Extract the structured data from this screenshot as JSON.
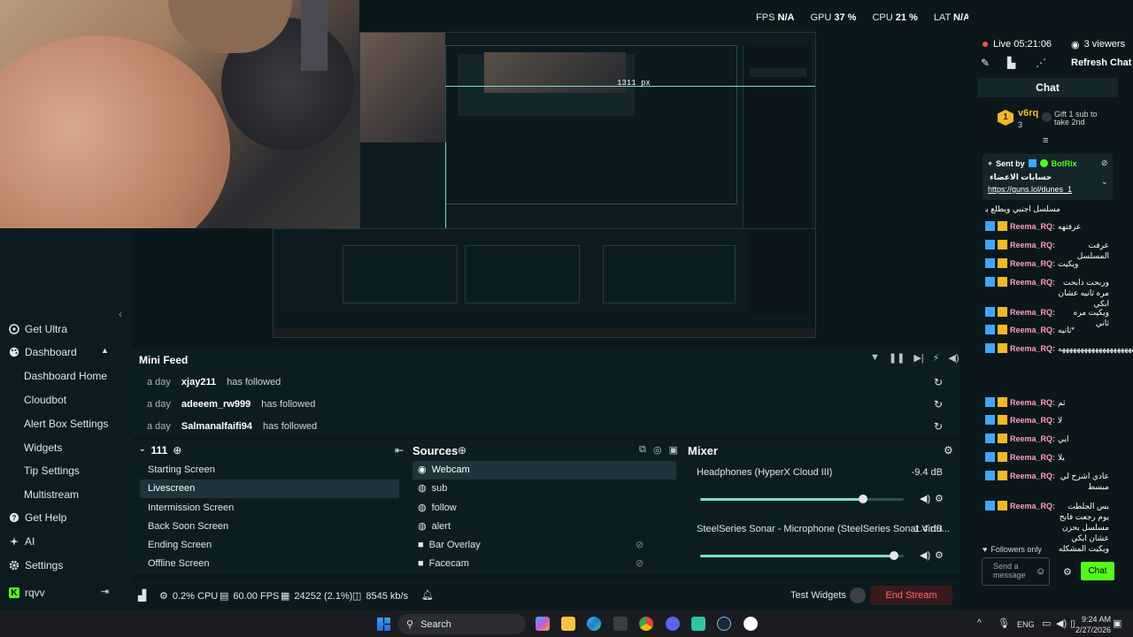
{
  "stats": {
    "fps_label": "FPS",
    "fps_value": "N/A",
    "gpu_label": "GPU",
    "gpu_value": "37 %",
    "cpu_label": "CPU",
    "cpu_value": "21 %",
    "lat_label": "LAT",
    "lat_value": "N/A"
  },
  "live": {
    "status": "Live 05:21:06",
    "viewers": "3 viewers",
    "refresh": "Refresh Chat"
  },
  "sidebar": {
    "get_ultra": "Get Ultra",
    "dashboard": "Dashboard",
    "dashboard_home": "Dashboard Home",
    "cloudbot": "Cloudbot",
    "alert_box": "Alert Box Settings",
    "widgets": "Widgets",
    "tip_settings": "Tip Settings",
    "multistream": "Multistream",
    "get_help": "Get Help",
    "ai": "AI",
    "settings": "Settings",
    "user": "rqvv"
  },
  "preview": {
    "measure_label": "1311 px"
  },
  "minifeed": {
    "title": "Mini Feed",
    "rows": [
      {
        "age": "a day",
        "user": "xjay211",
        "action": "has followed"
      },
      {
        "age": "a day",
        "user": "adeeem_rw999",
        "action": "has followed"
      },
      {
        "age": "a day",
        "user": "Salmanalfaifi94",
        "action": "has followed"
      }
    ]
  },
  "scenes": {
    "collection": "111",
    "items": [
      "Starting Screen",
      "Livescreen",
      "Intermission Screen",
      "Back Soon Screen",
      "Ending Screen",
      "Offline Screen"
    ]
  },
  "sources": {
    "title": "Sources",
    "items": [
      "Webcam",
      "sub",
      "follow",
      "alert",
      "Bar Overlay",
      "Facecam"
    ]
  },
  "mixer": {
    "title": "Mixer",
    "channels": [
      {
        "name": "Headphones (HyperX Cloud III)",
        "db": "-9.4 dB",
        "level": 0.8
      },
      {
        "name": "SteelSeries Sonar - Microphone (SteelSeries Sonar Virtu...",
        "db": "-1.4 dB",
        "level": 0.95
      }
    ]
  },
  "statusbar": {
    "cpu": "0.2% CPU",
    "fps": "60.00 FPS",
    "frames": "24252 (2.1%)",
    "bitrate": "8545 kb/s",
    "test_widgets": "Test Widgets",
    "end_stream": "End Stream"
  },
  "chat": {
    "title": "Chat",
    "top_user": "v6rq",
    "top_rank": "3",
    "gift_text": "Gift 1 sub to take 2nd",
    "pinned_label": "Sent by",
    "pinned_bot": "BotRix",
    "pinned_title": "حسابات الاعضاء",
    "pinned_link": "https://guns.lol/dunes_1",
    "overflow_line": "مسلسل اجنبي ويطلع بحزن",
    "messages": [
      {
        "name": "Reema_RQ:",
        "msg": "عرفتهه"
      },
      {
        "name": "Reema_RQ:",
        "msg": "عرفت المسلسل"
      },
      {
        "name": "Reema_RQ:",
        "msg": "ويكيت"
      },
      {
        "name": "Reema_RQ:",
        "msg": "وربحت ذابحت مره ثانيه عشان ابكي"
      },
      {
        "name": "Reema_RQ:",
        "msg": "ويكيت مره ثاني"
      },
      {
        "name": "Reema_RQ:",
        "msg": "*ثانيه"
      },
      {
        "name": "Reema_RQ:",
        "msg": "ههههههههههههههههههههههههههههه"
      },
      {
        "name": "Reema_RQ:",
        "msg": "ثم"
      },
      {
        "name": "Reema_RQ:",
        "msg": "لا"
      },
      {
        "name": "Reema_RQ:",
        "msg": "ايي"
      },
      {
        "name": "Reema_RQ:",
        "msg": "يلا"
      },
      {
        "name": "Reema_RQ:",
        "msg": "عادي اشرح لي مبسط"
      },
      {
        "name": "Reema_RQ:",
        "msg": "بس الجلطت يوم رجعت فابح مسلسل بحزن عشان ابكي ويكيت المشكله"
      }
    ],
    "followers_only": "Followers only",
    "input_placeholder": "Send a message",
    "send_label": "Chat"
  },
  "taskbar": {
    "search_label": "Search",
    "lang": "ENG",
    "time": "9:24 AM",
    "date": "2/27/2026"
  },
  "colors": {
    "accent": "#53fc18",
    "teal": "#78e3c5",
    "end_stream": "#ff6b6b",
    "badge_blue": "#3fa6ff"
  }
}
